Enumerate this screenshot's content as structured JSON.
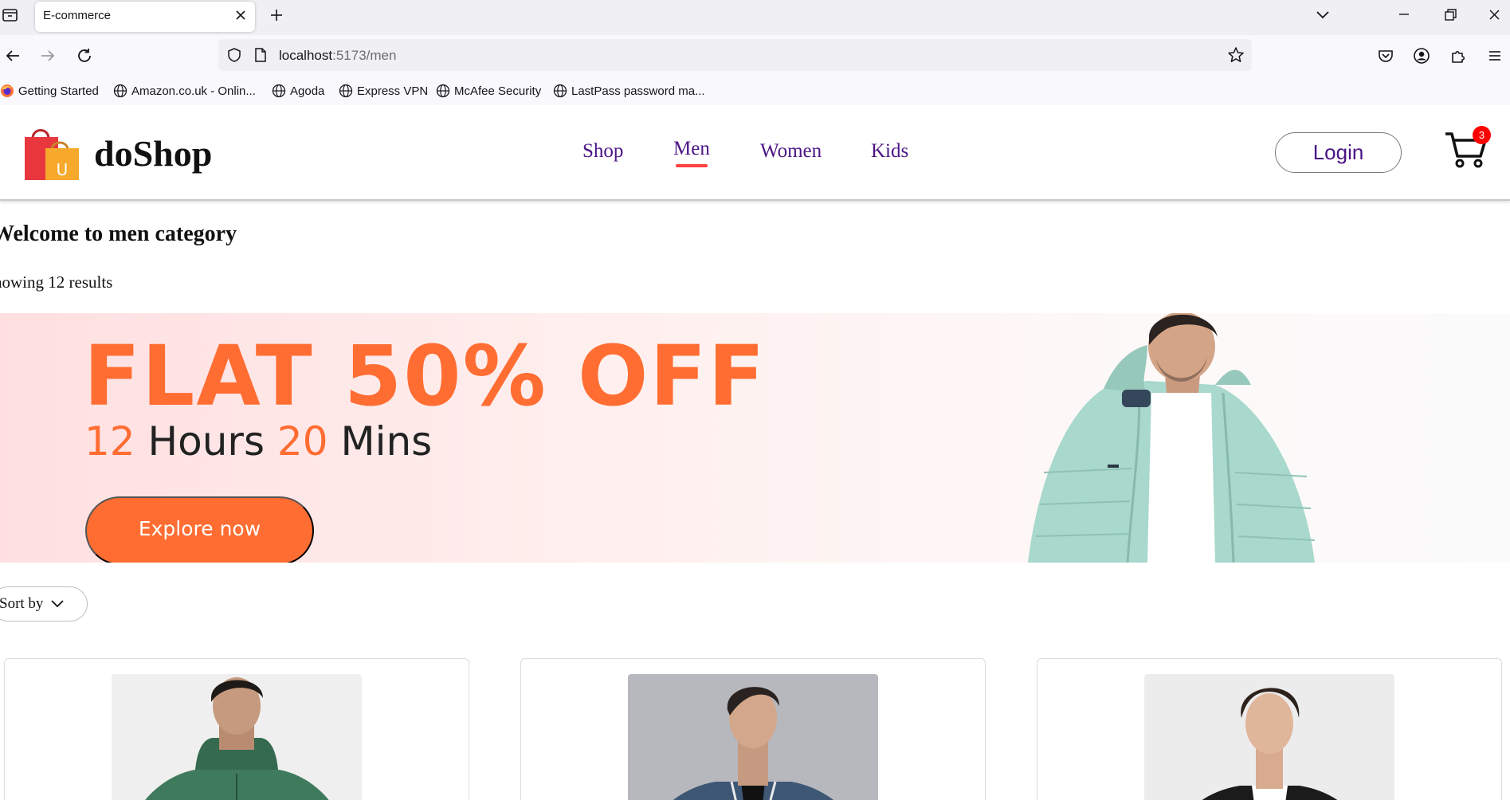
{
  "browser": {
    "tab_title": "E-commerce",
    "url_host": "localhost",
    "url_path": ":5173/men",
    "bookmarks": [
      "Getting Started",
      "Amazon.co.uk - Onlin...",
      "Agoda",
      "Express VPN",
      "McAfee Security",
      "LastPass password ma..."
    ]
  },
  "header": {
    "brand": "doShop",
    "menu": [
      "Shop",
      "Men",
      "Women",
      "Kids"
    ],
    "active_menu": "Men",
    "login_label": "Login",
    "cart_count": "3"
  },
  "page": {
    "title": "Welcome to men category",
    "results": "howing 12 results"
  },
  "banner": {
    "headline": "FLAT 50% OFF",
    "timer_hours": "12",
    "timer_hours_label": "Hours",
    "timer_mins": "20",
    "timer_mins_label": "Mins",
    "cta": "Explore now"
  },
  "sort": {
    "label": "Sort by"
  },
  "colors": {
    "accent": "#ff6d32",
    "menu_text": "#4b1485",
    "underline": "#ff4141",
    "badge": "#ff0000"
  },
  "products": [
    {
      "jacket_color": "#3f7a5c",
      "bg": "#efefef"
    },
    {
      "jacket_color": "#3d5775",
      "bg": "#b7b8bd"
    },
    {
      "jacket_color": "#1b1b1b",
      "bg": "#ececec"
    }
  ]
}
